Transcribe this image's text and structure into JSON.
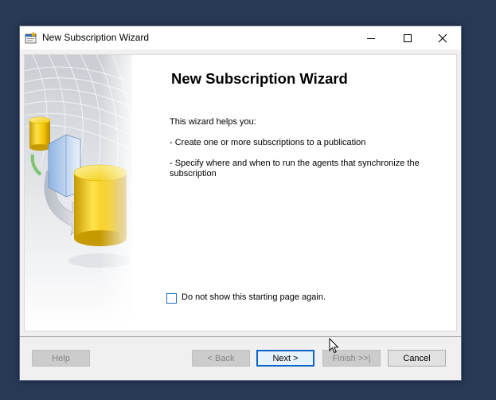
{
  "window": {
    "title": "New Subscription Wizard"
  },
  "page": {
    "heading": "New Subscription Wizard",
    "intro": "This wizard helps you:",
    "bullet1": " - Create one or more subscriptions to a publication",
    "bullet2": " - Specify where and when to run the agents that synchronize the subscription"
  },
  "checkbox": {
    "label": "Do not show this starting page again.",
    "checked": false
  },
  "buttons": {
    "help": "Help",
    "back": "< Back",
    "next": "Next >",
    "finish": "Finish >>|",
    "cancel": "Cancel"
  },
  "colors": {
    "desktop": "#283955",
    "accent": "#0a64c8"
  }
}
